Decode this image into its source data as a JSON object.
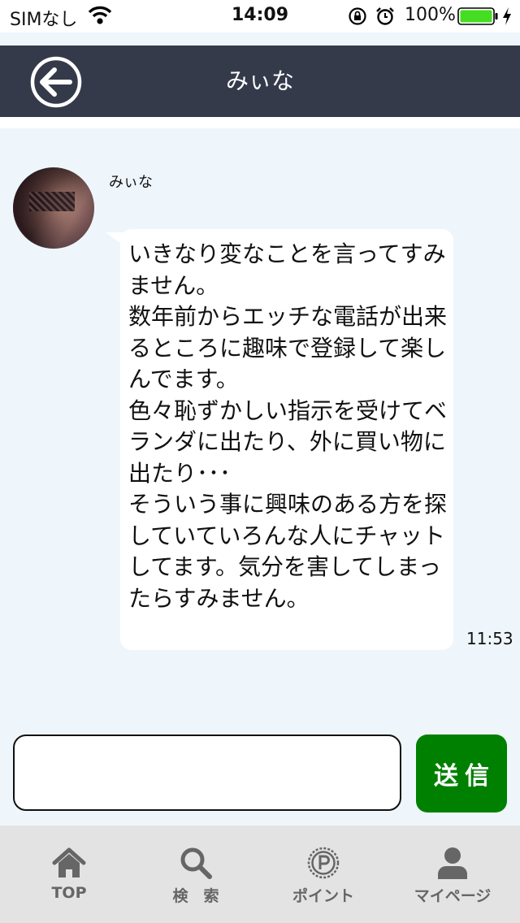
{
  "status_bar": {
    "carrier": "SIMなし",
    "time": "14:09",
    "battery": "100%"
  },
  "header": {
    "title": "みぃな"
  },
  "chat": {
    "sender_name": "みぃな",
    "message": "いきなり変なことを言ってすみません。\n数年前からエッチな電話が出来るところに趣味で登録して楽しんでます。\n色々恥ずかしい指示を受けてベランダに出たり、外に買い物に出たり･･･\nそういう事に興味のある方を探していていろんな人にチャットしてます。気分を害してしまったらすみません。",
    "time": "11:53"
  },
  "composer": {
    "input_value": "",
    "send_label": "送信"
  },
  "tab_bar": {
    "items": [
      {
        "label": "TOP",
        "icon": "home-icon"
      },
      {
        "label": "検　索",
        "icon": "search-icon"
      },
      {
        "label": "ポイント",
        "icon": "point-icon"
      },
      {
        "label": "マイページ",
        "icon": "user-icon"
      }
    ]
  },
  "colors": {
    "header_bg": "#353a4b",
    "chat_bg": "#eef6fc",
    "send_button": "#008000",
    "battery": "#44dd22",
    "tab_bar_bg": "#e3e3e3"
  }
}
